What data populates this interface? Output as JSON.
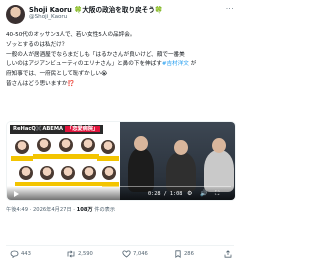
{
  "tweet": {
    "author_name": "Shoji Kaoru 🍀大阪の政治を取り戻そう🍀",
    "author_handle": "@Shoji_Kaoru",
    "more_label": "···",
    "lines": [
      "40-50代のオッサン3人で、若い女性5人の品評会。",
      "ゾッとするのは私だけ？",
      "一般の人が居酒屋でならまだしも「はるかさんが良いけど、顔で一番美",
      "しいのはアジアンビューティのエリナさん」と鼻の下を伸ばす",
      "府知事では、一府民として恥ずかしい",
      "皆さんはどう思いますか"
    ],
    "hashtag": "#吉村洋文",
    "line4_suffix": " が",
    "tears_emoji": "😭",
    "question_emoji": "⁉️"
  },
  "video": {
    "brand": "ReHacQ",
    "brand_sep": "✖️",
    "network": "ABEMA",
    "show_tag": "「恋愛病院」",
    "current_time": "0:28",
    "duration": "1:08",
    "progress": 0.41
  },
  "meta": {
    "posted": "午後4:49 · 2026年4月27日 · ",
    "views_count": "108万",
    "views_label": " 件の表示"
  },
  "actions": {
    "replies": "443",
    "reposts": "2,590",
    "likes": "7,046",
    "bookmarks": "286"
  }
}
